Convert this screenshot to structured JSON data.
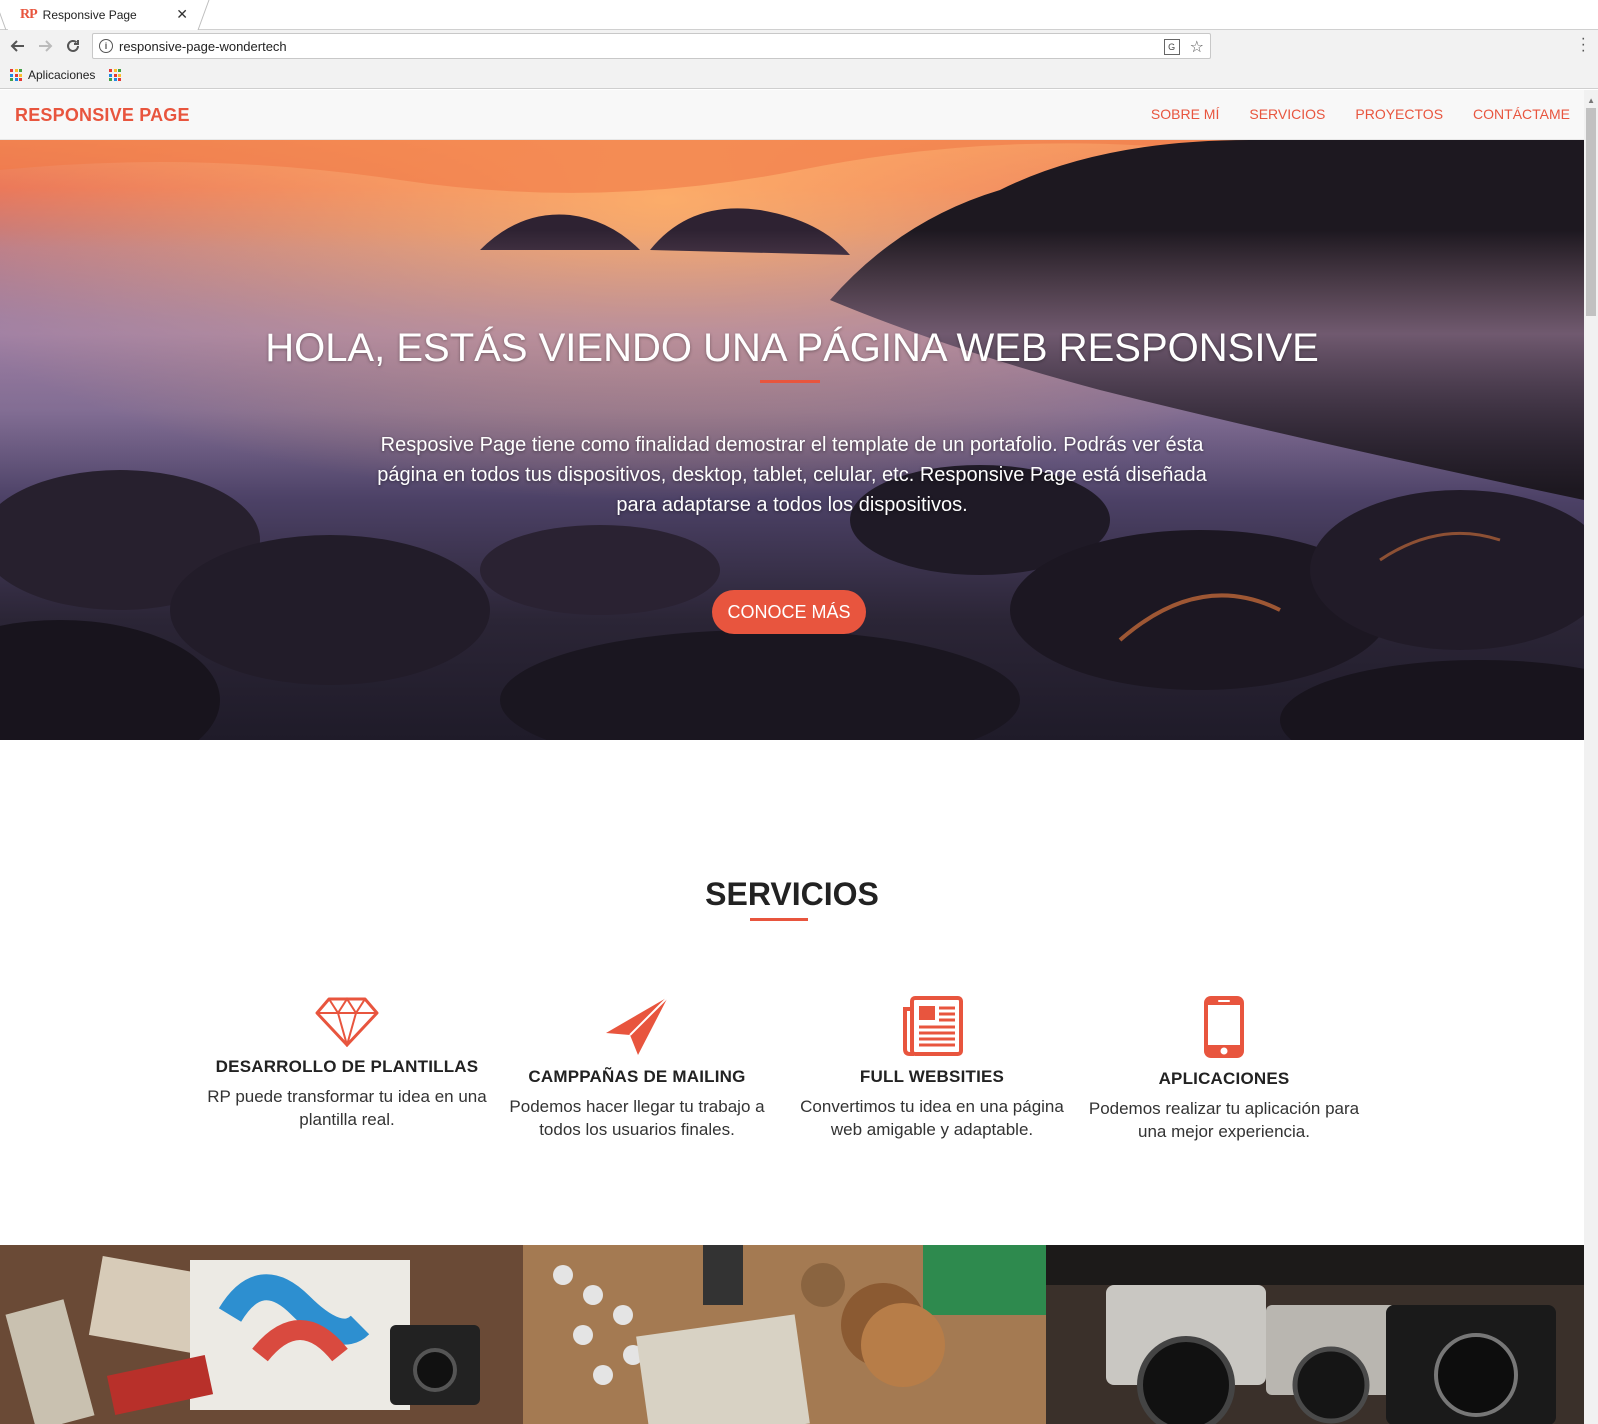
{
  "browser": {
    "tab_title": "Responsive Page",
    "tab_favicon": "RP",
    "url": "responsive-page-wondertech",
    "bookmark_label": "Aplicaciones",
    "icons": [
      "back-arrow-icon",
      "forward-arrow-icon",
      "reload-icon",
      "info-icon",
      "translate-icon",
      "star-icon",
      "menu-icon",
      "apps-icon"
    ]
  },
  "navbar": {
    "brand": "RESPONSIVE PAGE",
    "links": [
      "SOBRE MÍ",
      "SERVICIOS",
      "PROYECTOS",
      "CONTÁCTAME"
    ]
  },
  "hero": {
    "title": "HOLA, ESTÁS VIENDO UNA PÁGINA WEB RESPONSIVE",
    "text": "Resposive Page tiene como finalidad demostrar el template de un portafolio. Podrás ver ésta página en todos tus dispositivos, desktop, tablet, celular, etc. Responsive Page está diseñada para adaptarse a todos los dispositivos.",
    "button": "CONOCE MÁS"
  },
  "services": {
    "title": "SERVICIOS",
    "items": [
      {
        "icon": "diamond-icon",
        "title": "DESARROLLO DE PLANTILLAS",
        "desc": "RP puede transformar tu idea en una plantilla real."
      },
      {
        "icon": "paper-plane-icon",
        "title": "CAMPPAÑAS DE MAILING",
        "desc": "Podemos hacer llegar tu trabajo a todos los usuarios finales."
      },
      {
        "icon": "newspaper-icon",
        "title": "FULL WEBSITIES",
        "desc": "Convertimos tu idea en una página web amigable y adaptable."
      },
      {
        "icon": "mobile-phone-icon",
        "title": "APLICACIONES",
        "desc": "Podemos realizar tu aplicación para una mejor experiencia."
      }
    ]
  },
  "colors": {
    "accent": "#e8553e",
    "navbar_bg": "#f8f8f8",
    "text_dark": "#222222"
  }
}
